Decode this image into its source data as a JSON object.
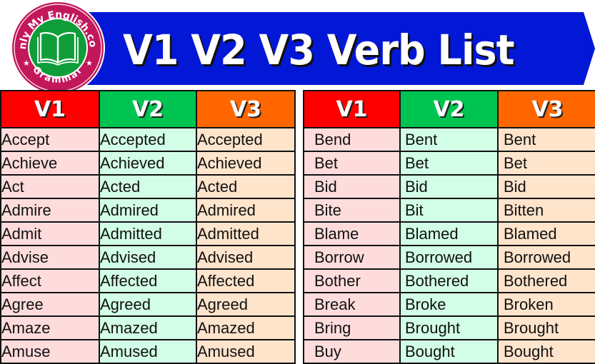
{
  "header": {
    "title": "V1 V2 V3 Verb List",
    "banner_color": "#0318d6",
    "logo": {
      "top_text": "Only My English.com",
      "bottom_text": "Grammar",
      "ring_color": "#c2185b",
      "inner_color": "#0f9d3a",
      "icon": "open-book-icon"
    }
  },
  "columns": {
    "v1": "V1",
    "v2": "V2",
    "v3": "V3"
  },
  "colors": {
    "v1_header": "#fe0000",
    "v2_header": "#00c451",
    "v3_header": "#ff6600",
    "v1_cell": "#ffdcdc",
    "v2_cell": "#d2fde6",
    "v3_cell": "#ffe4cc"
  },
  "left_table": [
    [
      "Accept",
      "Accepted",
      "Accepted"
    ],
    [
      "Achieve",
      "Achieved",
      "Achieved"
    ],
    [
      "Act",
      "Acted",
      "Acted"
    ],
    [
      "Admire",
      "Admired",
      "Admired"
    ],
    [
      "Admit",
      "Admitted",
      "Admitted"
    ],
    [
      "Advise",
      "Advised",
      "Advised"
    ],
    [
      "Affect",
      "Affected",
      "Affected"
    ],
    [
      "Agree",
      "Agreed",
      "Agreed"
    ],
    [
      "Amaze",
      "Amazed",
      "Amazed"
    ],
    [
      "Amuse",
      "Amused",
      "Amused"
    ]
  ],
  "right_table": [
    [
      "Bend",
      "Bent",
      "Bent"
    ],
    [
      "Bet",
      "Bet",
      "Bet"
    ],
    [
      "Bid",
      "Bid",
      "Bid"
    ],
    [
      "Bite",
      "Bit",
      "Bitten"
    ],
    [
      "Blame",
      "Blamed",
      "Blamed"
    ],
    [
      "Borrow",
      "Borrowed",
      "Borrowed"
    ],
    [
      "Bother",
      "Bothered",
      "Bothered"
    ],
    [
      "Break",
      "Broke",
      "Broken"
    ],
    [
      "Bring",
      "Brought",
      "Brought"
    ],
    [
      "Buy",
      "Bought",
      "Bought"
    ]
  ]
}
